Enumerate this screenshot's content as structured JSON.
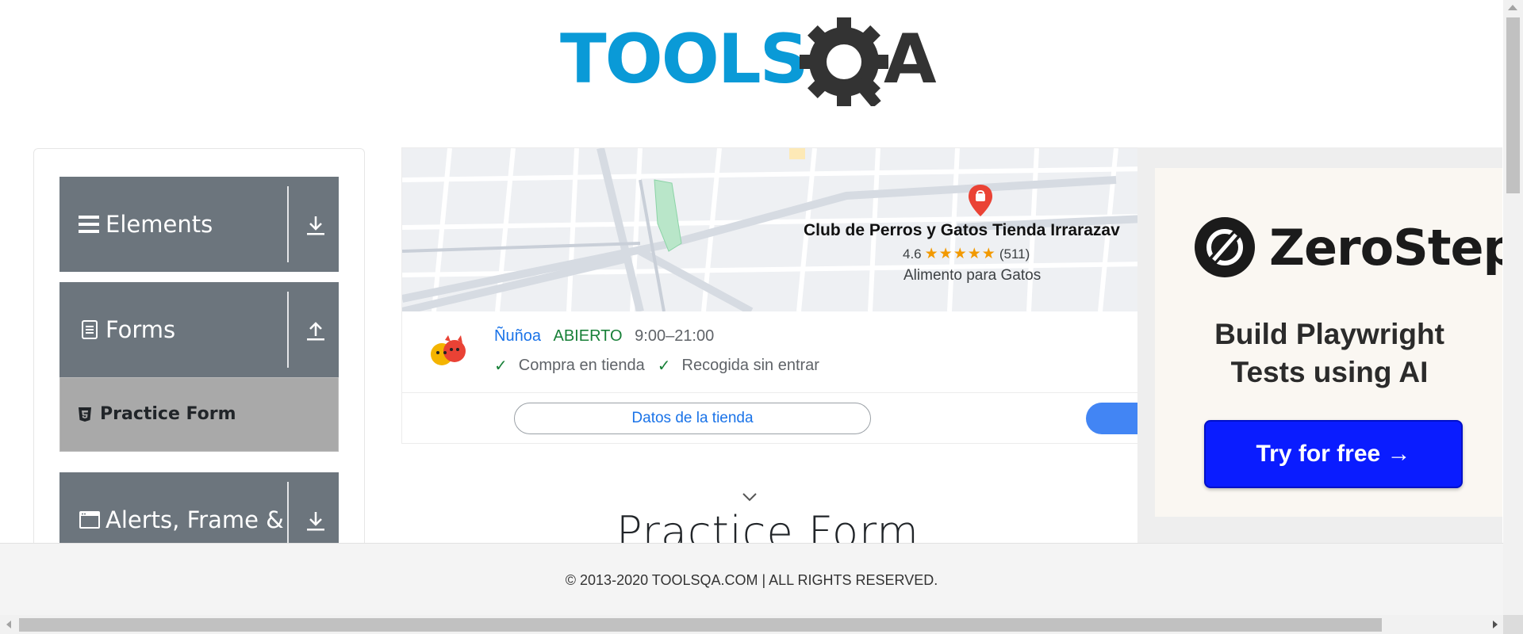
{
  "header": {
    "logo_text_left": "TOOLS",
    "logo_text_right": "QA"
  },
  "sidebar": {
    "groups": [
      {
        "title": "Elements",
        "icon": "hamburger-icon",
        "expanded": false,
        "arrow": "arrow-down-icon"
      },
      {
        "title": "Forms",
        "icon": "document-icon",
        "expanded": true,
        "arrow": "arrow-up-icon",
        "items": [
          {
            "label": "Practice Form",
            "icon": "html5-icon",
            "active": true
          }
        ]
      },
      {
        "title": "Alerts, Frame &",
        "icon": "window-icon",
        "expanded": false,
        "arrow": "arrow-down-icon"
      }
    ]
  },
  "map_ad": {
    "store_name": "Club de Perros y Gatos Tienda Irrarazav",
    "rating": "4.6",
    "stars": "★★★★★",
    "review_count": "(511)",
    "category": "Alimento para Gatos",
    "location": "Ñuñoa",
    "status": "ABIERTO",
    "hours": "9:00–21:00",
    "features": [
      "Compra en tienda",
      "Recogida sin entrar"
    ],
    "details_button": "Datos de la tienda",
    "colors": {
      "link": "#1a73e8",
      "open": "#188038",
      "star": "#f29900",
      "pin": "#ea4335"
    }
  },
  "zerostep_ad": {
    "brand": "ZeroStep",
    "tagline_line1": "Build Playwright",
    "tagline_line2": "Tests using AI",
    "cta": "Try for free →",
    "colors": {
      "cta_bg": "#0a1cff"
    }
  },
  "main": {
    "title": "Practice Form"
  },
  "footer": {
    "text": "© 2013-2020 TOOLSQA.COM | ALL RIGHTS RESERVED."
  },
  "theme": {
    "sidebar_header_bg": "#6c757d",
    "sidebar_active_bg": "#a9a9a9",
    "logo_blue": "#0a9ad7",
    "logo_dark": "#333333"
  }
}
